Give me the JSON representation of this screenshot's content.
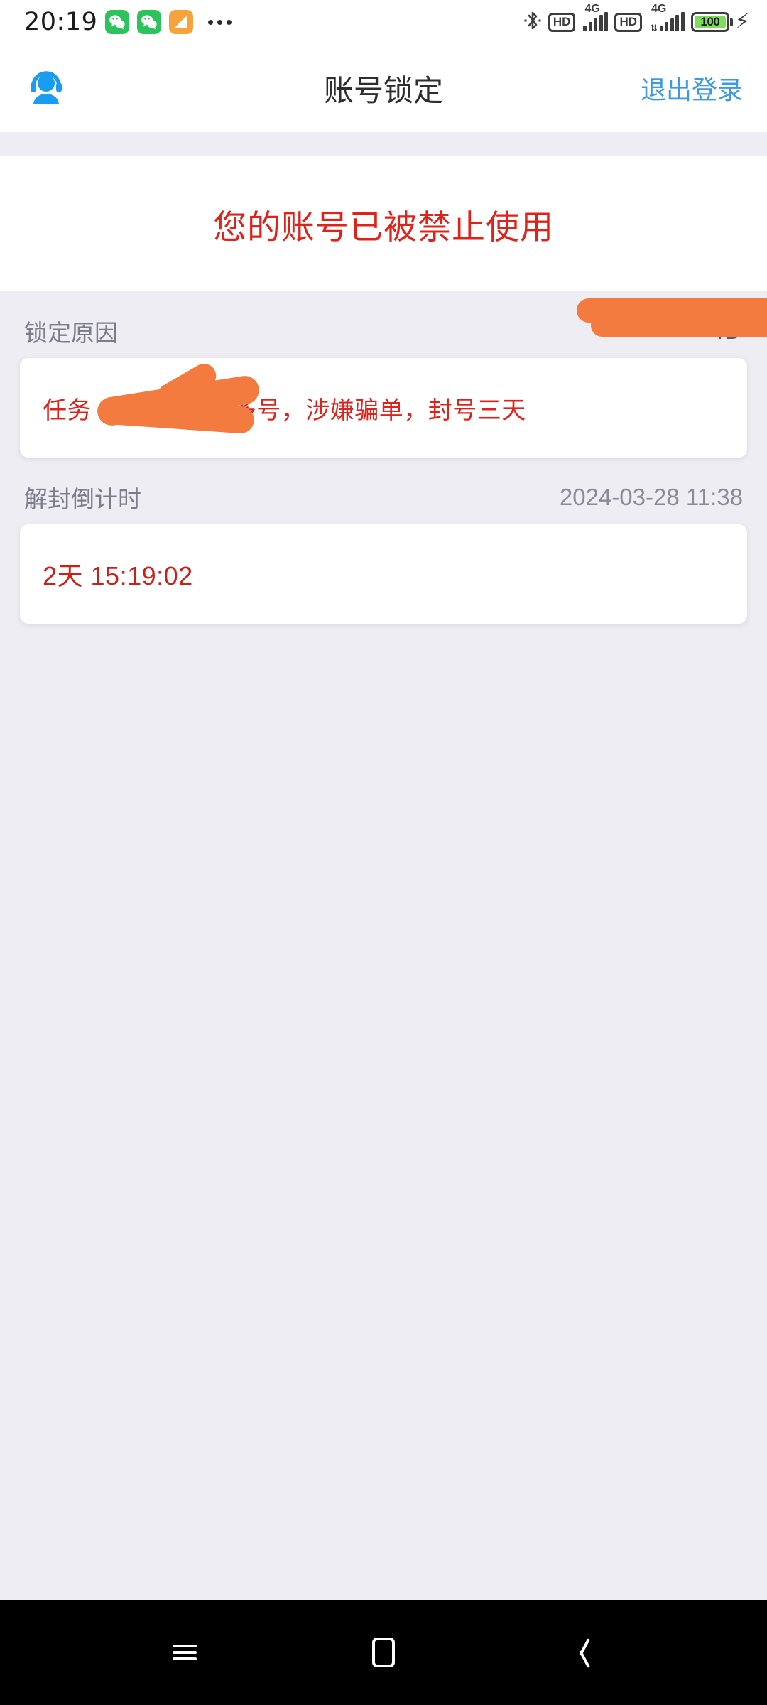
{
  "status_bar": {
    "clock": "20:19",
    "app_icons": [
      "wechat-icon",
      "wechat-icon",
      "orange-note-icon"
    ],
    "overflow": "more-apps-dots",
    "bluetooth": "bluetooth-icon",
    "sim1": {
      "hd": "HD",
      "network": "4G"
    },
    "sim2": {
      "hd": "HD",
      "network": "4G"
    },
    "battery": {
      "level": "100",
      "charging": true
    },
    "colors": {
      "wechat_green": "#2cc35d",
      "orange": "#f7a33c",
      "battery_green": "#7ddc5a"
    }
  },
  "header": {
    "avatar_icon": "support-agent-icon",
    "title": "账号锁定",
    "logout_label": "退出登录",
    "link_color": "#3b9ae1"
  },
  "banner": {
    "message": "您的账号已被禁止使用",
    "color": "#e0231a"
  },
  "reason_section": {
    "label": "锁定原因",
    "value_masked": "ID",
    "card_text": "任务 1050-2 一人多号，涉嫌骗单，封号三天",
    "text_color": "#e0231a"
  },
  "countdown_section": {
    "label": "解封倒计时",
    "release_datetime": "2024-03-28 11:38",
    "remaining": "2天 15:19:02",
    "text_color": "#cc1f17"
  },
  "nav_bar": {
    "recents": "recents-icon",
    "home": "home-icon",
    "back": "back-icon"
  },
  "redaction": {
    "color": "#f47b3f"
  }
}
